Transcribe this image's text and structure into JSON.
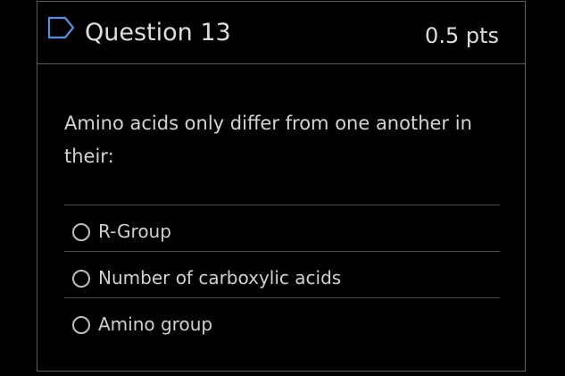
{
  "question": {
    "title": "Question 13",
    "points": "0.5 pts",
    "flag_icon": "flag-outline-icon",
    "prompt": "Amino acids only differ from one another in their:",
    "answers": [
      {
        "label": "R-Group"
      },
      {
        "label": "Number of carboxylic acids"
      },
      {
        "label": "Amino group"
      }
    ]
  },
  "colors": {
    "background": "#000000",
    "border": "#5c5c5c",
    "text": "#d9d9d9",
    "flag": "#5b8dd9"
  }
}
